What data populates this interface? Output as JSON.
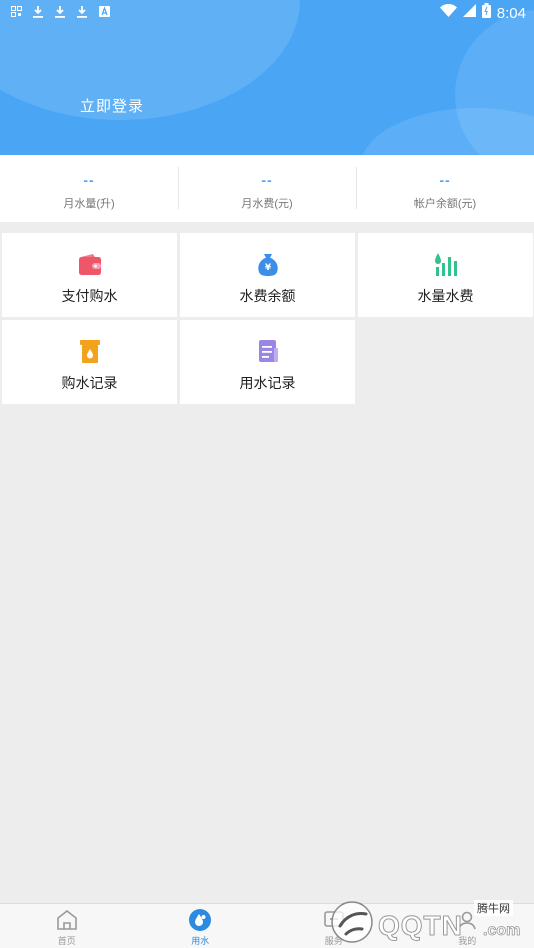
{
  "status_bar": {
    "time": "8:04"
  },
  "header": {
    "login_label": "立即登录"
  },
  "stats": [
    {
      "value": "--",
      "label": "月水量(升)"
    },
    {
      "value": "--",
      "label": "月水费(元)"
    },
    {
      "value": "--",
      "label": "帐户余额(元)"
    }
  ],
  "grid": [
    {
      "label": "支付购水",
      "icon": "wallet-icon",
      "color": "#f0566a"
    },
    {
      "label": "水费余额",
      "icon": "money-bag-icon",
      "color": "#3b8fe6"
    },
    {
      "label": "水量水费",
      "icon": "water-chart-icon",
      "color": "#33c18e"
    },
    {
      "label": "购水记录",
      "icon": "purchase-record-icon",
      "color": "#f2a21c"
    },
    {
      "label": "用水记录",
      "icon": "usage-record-icon",
      "color": "#9b86e6"
    }
  ],
  "bottom_nav": [
    {
      "label": "首页",
      "icon": "home-icon"
    },
    {
      "label": "用水",
      "icon": "water-drop-icon",
      "active": true
    },
    {
      "label": "服务",
      "icon": "service-icon"
    },
    {
      "label": "我的",
      "icon": "profile-icon"
    }
  ],
  "watermark": {
    "brand": "QQTN",
    "site_label": "腾牛网",
    "domain": ".com"
  },
  "colors": {
    "primary": "#4aa6f5",
    "background": "#ededed",
    "active_nav": "#2c8ae0"
  }
}
